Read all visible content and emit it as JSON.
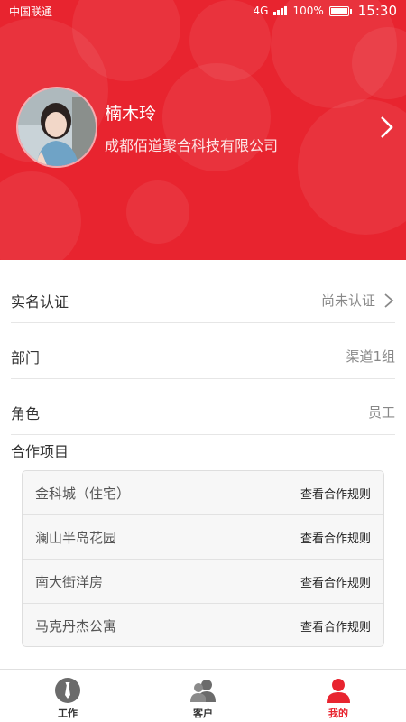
{
  "status_bar": {
    "carrier": "中国联通",
    "network": "4G",
    "battery": "100%",
    "time": "15:30"
  },
  "profile": {
    "name": "楠木玲",
    "company": "成都佰道聚合科技有限公司"
  },
  "info_rows": [
    {
      "label": "实名认证",
      "value": "尚未认证"
    },
    {
      "label": "部门",
      "value": "渠道1组"
    },
    {
      "label": "角色",
      "value": "员工"
    }
  ],
  "projects": {
    "title": "合作项目",
    "items": [
      {
        "name": "金科城（住宅）",
        "action": "查看合作规则"
      },
      {
        "name": "澜山半岛花园",
        "action": "查看合作规则"
      },
      {
        "name": "南大街洋房",
        "action": "查看合作规则"
      },
      {
        "name": "马克丹杰公寓",
        "action": "查看合作规则"
      }
    ]
  },
  "tab_bar": {
    "tabs": [
      {
        "label": "工作",
        "icon": "tie-icon"
      },
      {
        "label": "客户",
        "icon": "customers-icon"
      },
      {
        "label": "我的",
        "icon": "profile-icon"
      }
    ],
    "active": "我的"
  },
  "colors": {
    "brand_red": "#e8242f"
  }
}
